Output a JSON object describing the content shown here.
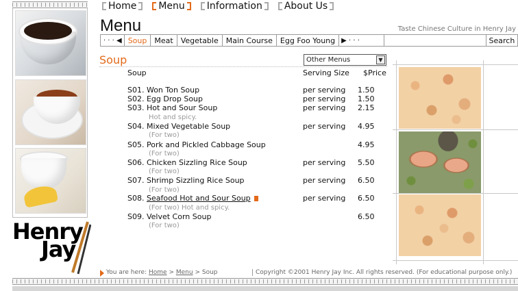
{
  "nav": {
    "items": [
      {
        "label": "Home"
      },
      {
        "label": "Menu"
      },
      {
        "label": "Information"
      },
      {
        "label": "About Us"
      }
    ]
  },
  "page_title": "Menu",
  "tagline": "Taste Chinese Culture in Henry Jay",
  "tabs": {
    "prev": "· · · ◀",
    "items": [
      "Soup",
      "Meat",
      "Vegetable",
      "Main Course",
      "Egg Foo Young"
    ],
    "next": "▶ · · ·",
    "search_value": "",
    "search_label": "Search"
  },
  "section_title": "Soup",
  "other_menus": "Other Menus",
  "headers": {
    "name": "Soup",
    "size": "Serving Size",
    "price": "$Price"
  },
  "items": [
    {
      "name": "S01. Won Ton Soup",
      "size": "per serving",
      "price": "1.50",
      "note": ""
    },
    {
      "name": "S02. Egg Drop Soup",
      "size": "per serving",
      "price": "1.50",
      "note": ""
    },
    {
      "name": "S03. Hot and Sour Soup",
      "size": "per serving",
      "price": "2.15",
      "note": "Hot and spicy."
    },
    {
      "name": "S04. Mixed Vegetable Soup",
      "size": "per serving",
      "price": "4.95",
      "note": "(For two)"
    },
    {
      "name": "S05. Pork and Pickled Cabbage Soup",
      "size": "",
      "price": "4.95",
      "note": "(For two)"
    },
    {
      "name": "S06. Chicken Sizzling Rice Soup",
      "size": "per serving",
      "price": "5.50",
      "note": "(For two)"
    },
    {
      "name": "S07. Shrimp Sizzling Rice Soup",
      "size": "per serving",
      "price": "6.50",
      "note": "(For two)"
    },
    {
      "name_prefix": "S08. ",
      "name_link": "Seafood Hot and Sour Soup",
      "size": "per serving",
      "price": "6.50",
      "note": "(For two) Hot and spicy."
    },
    {
      "name": "S09. Velvet Corn Soup",
      "size": "",
      "price": "6.50",
      "note": "(For two)"
    }
  ],
  "logo": {
    "line1": "Henry",
    "line2": "Jay"
  },
  "footer": {
    "you_are_here": "You are here:",
    "crumb_home": "Home",
    "sep": ">",
    "crumb_menu": "Menu",
    "crumb_current": "Soup",
    "copyright": "Copyright ©2001 Henry Jay Inc. All rights reserved. (For educational purpose only.)"
  },
  "colors": {
    "accent": "#e36a1a"
  }
}
